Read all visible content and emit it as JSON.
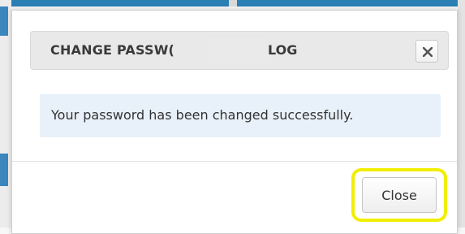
{
  "dialog": {
    "title_visible": "CHANGE PASSW(",
    "title_tail": "LOG",
    "close_icon": "close-x-icon",
    "message": "Your password has been changed successfully.",
    "close_button_label": "Close"
  },
  "colors": {
    "header_bg": "#e9e9e9",
    "alert_bg": "#e8f1f9",
    "highlight": "#f2ee00",
    "background_accent": "#2a7fb5"
  }
}
